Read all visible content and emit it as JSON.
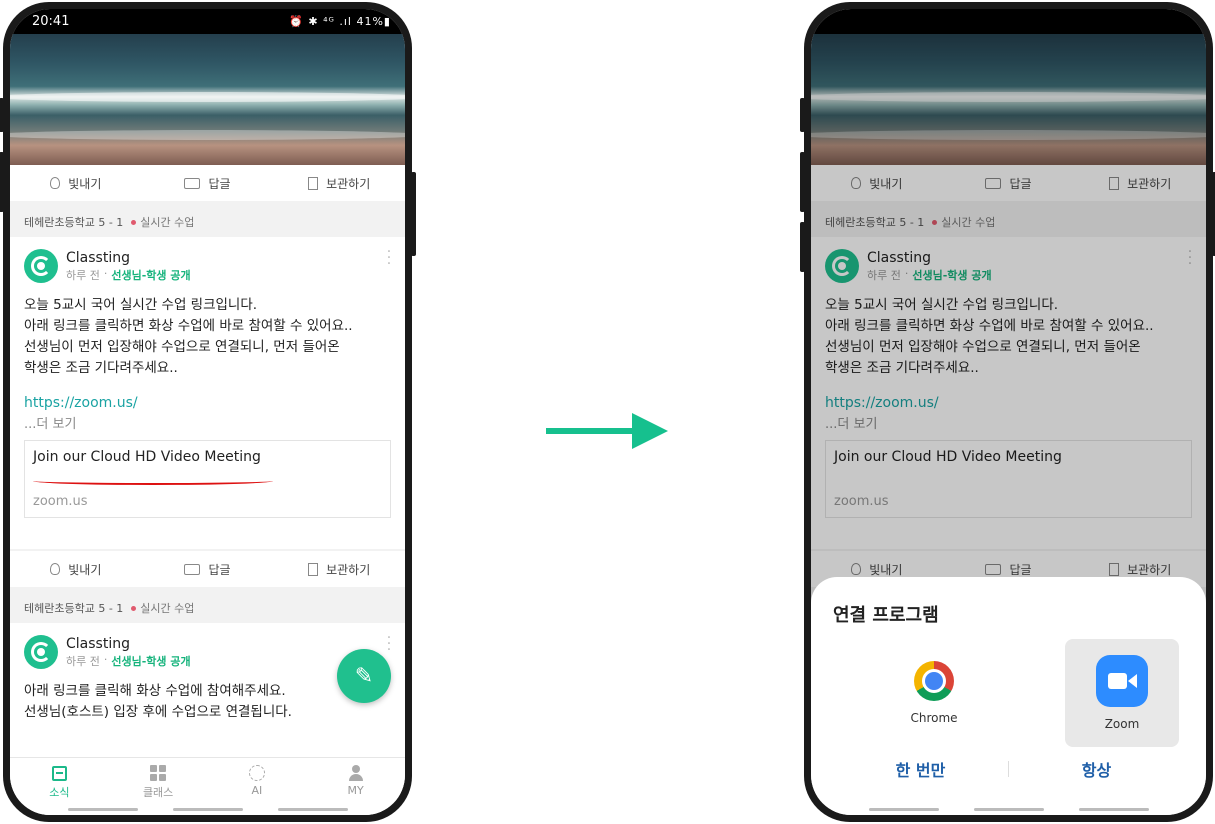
{
  "status_bar": {
    "time": "20:41",
    "icons": "⏰ ✱ ⁴ᴳ .ıl",
    "battery": "41%▮"
  },
  "feed": {
    "actions": {
      "shine": "빛내기",
      "reply": "답글",
      "save": "보관하기"
    },
    "posts": [
      {
        "class_name": "테헤란초등학교 5 - 1",
        "live_tag": "실시간 수업",
        "author": "Classting",
        "time": "하루 전",
        "visibility": "선생님-학생 공개",
        "body": "오늘 5교시 국어 실시간 수업 링크입니다.\n아래 링크를 클릭하면 화상 수업에 바로 참여할 수 있어요..\n선생님이 먼저 입장해야 수업으로 연결되니, 먼저 들어온\n학생은 조금 기다려주세요..",
        "link": "https://zoom.us/",
        "more": "...더 보기",
        "preview_title": "Join our Cloud HD Video Meeting",
        "preview_domain": "zoom.us"
      },
      {
        "class_name": "테헤란초등학교 5 - 1",
        "live_tag": "실시간 수업",
        "author": "Classting",
        "time": "하루 전",
        "visibility": "선생님-학생 공개",
        "body": "아래 링크를 클릭해 화상 수업에 참여해주세요.\n선생님(호스트) 입장 후에 수업으로 연결됩니다."
      }
    ]
  },
  "tabbar": [
    {
      "label": "소식",
      "icon": "feed-icon",
      "active": true
    },
    {
      "label": "클래스",
      "icon": "grid-icon",
      "active": false
    },
    {
      "label": "AI",
      "icon": "ai-icon",
      "active": false
    },
    {
      "label": "MY",
      "icon": "user-icon",
      "active": false
    }
  ],
  "sheet": {
    "title": "연결 프로그램",
    "apps": [
      {
        "label": "Chrome",
        "icon": "chrome-icon",
        "selected": false
      },
      {
        "label": "Zoom",
        "icon": "zoom-icon",
        "selected": true
      }
    ],
    "once": "한 번만",
    "always": "항상"
  },
  "colors": {
    "brand": "#1cb98a",
    "link": "#1aa3a3",
    "arrow": "#16c08e",
    "sheet_action": "#1f5fa8",
    "annotation": "#dd1111"
  }
}
